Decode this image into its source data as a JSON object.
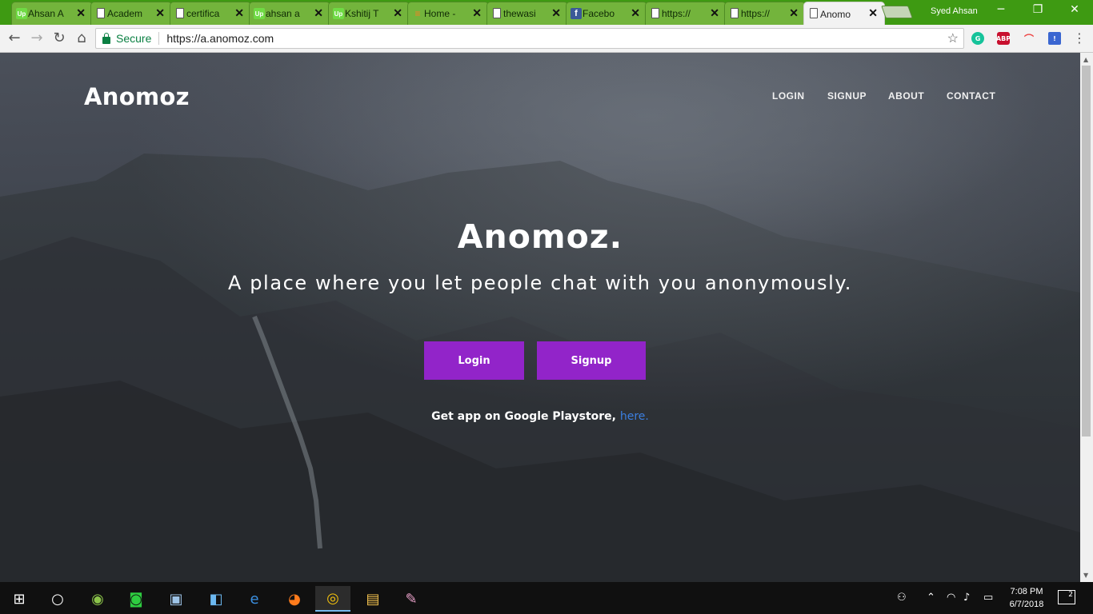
{
  "browser": {
    "tabs": [
      {
        "title": "Ahsan A",
        "icon": "upwork-icon",
        "active": false
      },
      {
        "title": "Academ",
        "icon": "document-icon",
        "active": false
      },
      {
        "title": "certifica",
        "icon": "document-icon",
        "active": false
      },
      {
        "title": "ahsan a",
        "icon": "upwork-icon",
        "active": false
      },
      {
        "title": "Kshitij T",
        "icon": "upwork-icon",
        "active": false
      },
      {
        "title": "Home -",
        "icon": "stackoverflow-icon",
        "active": false
      },
      {
        "title": "thewasi",
        "icon": "document-icon",
        "active": false
      },
      {
        "title": "Facebo",
        "icon": "facebook-icon",
        "active": false
      },
      {
        "title": "https://",
        "icon": "document-icon",
        "active": false
      },
      {
        "title": "https://",
        "icon": "document-icon",
        "active": false
      },
      {
        "title": "Anomo",
        "icon": "document-icon",
        "active": true
      }
    ],
    "profile_name": "Syed Ahsan",
    "security_label": "Secure",
    "url": "https://a.anomoz.com"
  },
  "site": {
    "brand": "Anomoz",
    "nav": [
      "LOGIN",
      "SIGNUP",
      "ABOUT",
      "CONTACT"
    ],
    "hero_title": "Anomoz.",
    "hero_subtitle": "A place where you let people chat with you anonymously.",
    "login_button": "Login",
    "signup_button": "Signup",
    "app_text": "Get app on Google Playstore,",
    "app_link": "here.",
    "accent_color": "#9224c9",
    "link_color": "#3b7fe0"
  },
  "taskbar": {
    "time": "7:08 PM",
    "date": "6/7/2018",
    "notification_count": "2"
  }
}
